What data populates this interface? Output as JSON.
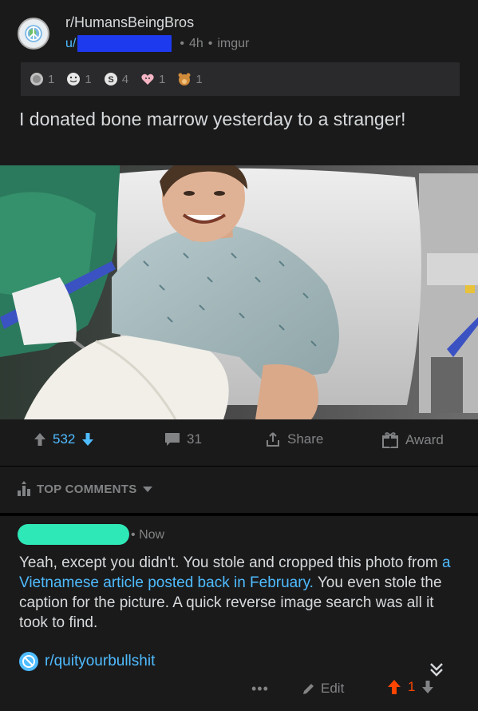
{
  "post": {
    "subreddit": "r/HumansBeingBros",
    "user_prefix": "u/",
    "age": "4h",
    "domain": "imgur",
    "awards": [
      {
        "name": "silver-award",
        "count": "1"
      },
      {
        "name": "wholesome-award",
        "count": "1"
      },
      {
        "name": "s-award",
        "count": "4"
      },
      {
        "name": "heart-award",
        "count": "1"
      },
      {
        "name": "bear-award",
        "count": "1"
      }
    ],
    "title": "I donated bone marrow yesterday to a stranger!",
    "upvotes": "532",
    "comments": "31",
    "share_label": "Share",
    "award_label": "Award"
  },
  "top_comments": {
    "label": "TOP COMMENTS"
  },
  "comment": {
    "age": "Now",
    "body_part1": "Yeah, except you didn't. You stole and cropped this photo from ",
    "link_text": "a Vietnamese article posted back in February.",
    "body_part2": " You even stole the caption for the picture. A quick reverse image search was all it took to find.",
    "subreddit": "r/quityourbullshit",
    "more": "•••",
    "edit_label": "Edit",
    "score": "1"
  },
  "colors": {
    "background": "#000000",
    "card": "#1a1a1b",
    "text": "#d7dadc",
    "muted": "#818384",
    "link": "#4fbcff",
    "upvote": "#ff4500",
    "redaction_blue": "#1e3aef",
    "redaction_green": "#2fe8b8"
  }
}
